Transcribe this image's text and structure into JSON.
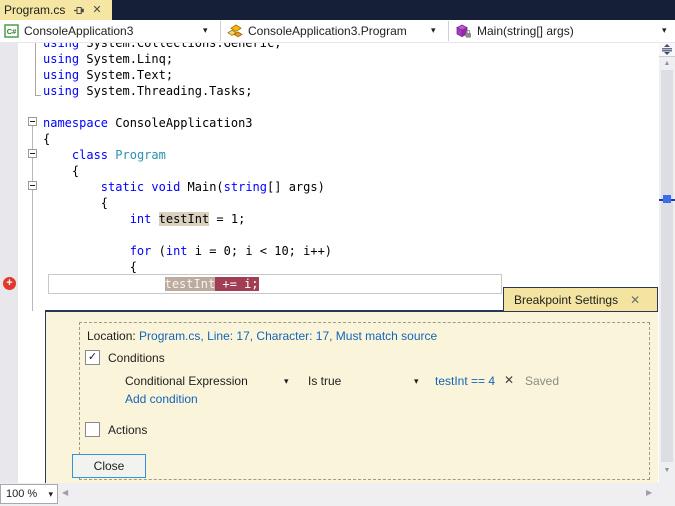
{
  "colors": {
    "accent_link": "#1464B8",
    "keyword_blue": "#0000FF",
    "type_teal": "#2B91AF",
    "breakpoint_line_red": "#A23E54",
    "breakpoint_glyph_red": "#E0382C",
    "symbol_highlight_tan": "#D9D0BE",
    "peek_body_bg": "#FAF5DA",
    "peek_tab_bg": "#F3E5A1",
    "active_tab_bg": "#F5E7A3",
    "tabwell_bg": "#151F38"
  },
  "tab_bar": {
    "active_tab": "Program.cs",
    "close_glyph": "✕"
  },
  "navbar": {
    "project": "ConsoleApplication3",
    "type": "ConsoleApplication3.Program",
    "member": "Main(string[] args)",
    "project_icon_label": "C#",
    "dropdown_glyph": "▾"
  },
  "code": {
    "lines": [
      [
        [
          "kw",
          "using"
        ],
        [
          "pl",
          " System.Collections.Generic;"
        ]
      ],
      [
        [
          "kw",
          "using"
        ],
        [
          "pl",
          " System.Linq;"
        ]
      ],
      [
        [
          "kw",
          "using"
        ],
        [
          "pl",
          " System.Text;"
        ]
      ],
      [
        [
          "kw",
          "using"
        ],
        [
          "pl",
          " System.Threading.Tasks;"
        ]
      ],
      [],
      [
        [
          "kw",
          "namespace"
        ],
        [
          "pl",
          " ConsoleApplication3"
        ]
      ],
      [
        [
          "pl",
          "{"
        ]
      ],
      [
        [
          "pl",
          "    "
        ],
        [
          "kw",
          "class"
        ],
        [
          "pl",
          " "
        ],
        [
          "ty",
          "Program"
        ]
      ],
      [
        [
          "pl",
          "    {"
        ]
      ],
      [
        [
          "pl",
          "        "
        ],
        [
          "kw",
          "static"
        ],
        [
          "pl",
          " "
        ],
        [
          "kw",
          "void"
        ],
        [
          "pl",
          " Main("
        ],
        [
          "kw",
          "string"
        ],
        [
          "pl",
          "[] args)"
        ]
      ],
      [
        [
          "pl",
          "        {"
        ]
      ],
      [
        [
          "pl",
          "            "
        ],
        [
          "kw",
          "int"
        ],
        [
          "pl",
          " "
        ],
        [
          "hl",
          "testInt"
        ],
        [
          "pl",
          " = 1;"
        ]
      ],
      [],
      [
        [
          "pl",
          "            "
        ],
        [
          "kw",
          "for"
        ],
        [
          "pl",
          " ("
        ],
        [
          "kw",
          "int"
        ],
        [
          "pl",
          " i = 0; i < 10; i++)"
        ]
      ],
      [
        [
          "pl",
          "            {"
        ]
      ]
    ],
    "breakpoint_line": [
      [
        "pl",
        "                "
      ],
      [
        "bpt",
        "testInt"
      ],
      [
        "bpr",
        " += i;"
      ]
    ],
    "breakpoint_glyph": "+"
  },
  "peek": {
    "tab_title": "Breakpoint Settings",
    "close_glyph": "✕",
    "location_label": "Location: ",
    "location_value": "Program.cs, Line: 17, Character: 17, Must match source",
    "conditions_label": "Conditions",
    "conditions_checked_glyph": "✓",
    "condition_type": "Conditional Expression",
    "condition_operator": "Is true",
    "condition_expression": "testInt == 4",
    "condition_delete_glyph": "✕",
    "saved_label": "Saved",
    "add_condition_label": "Add condition",
    "actions_label": "Actions",
    "close_label": "Close",
    "dropdown_glyph": "▾"
  },
  "scrollbar": {
    "up_glyph": "▲",
    "down_glyph": "▼",
    "left_glyph": "◀",
    "right_glyph": "▶"
  },
  "statusbar": {
    "zoom_level": "100 %",
    "dropdown_glyph": "▾"
  }
}
